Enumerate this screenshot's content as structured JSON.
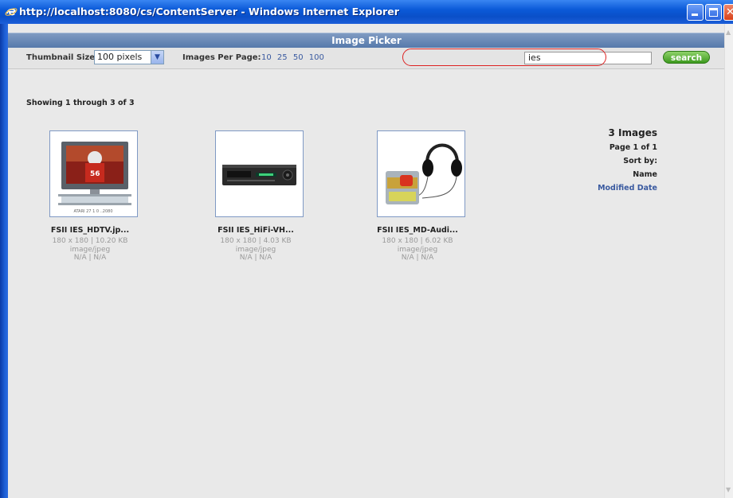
{
  "window": {
    "title": "http://localhost:8080/cs/ContentServer - Windows Internet Explorer"
  },
  "dialog": {
    "title": "Image Picker"
  },
  "toolbar": {
    "thumbnail_label": "Thumbnail Size:",
    "thumbnail_value": "100 pixels",
    "per_page_label": "Images Per Page:",
    "per_page_options": [
      "10",
      "25",
      "50",
      "100"
    ],
    "search_value": "ies",
    "search_button": "search"
  },
  "results": {
    "showing": "Showing 1 through 3 of 3"
  },
  "images": [
    {
      "name": "FSII IES_HDTV.jp...",
      "dims": "180 x 180 | 10.20 KB",
      "type": "image/jpeg",
      "extra": "N/A | N/A",
      "thumb_caption": "ATARI  27 1 0 ..2080"
    },
    {
      "name": "FSII IES_HiFi-VH...",
      "dims": "180 x 180 | 4.03 KB",
      "type": "image/jpeg",
      "extra": "N/A | N/A"
    },
    {
      "name": "FSII IES_MD-Audi...",
      "dims": "180 x 180 | 6.02 KB",
      "type": "image/jpeg",
      "extra": "N/A | N/A"
    }
  ],
  "summary": {
    "count": "3 Images",
    "page": "Page 1 of 1",
    "sort_label": "Sort by:",
    "sort_name": "Name",
    "sort_modified": "Modified Date"
  }
}
